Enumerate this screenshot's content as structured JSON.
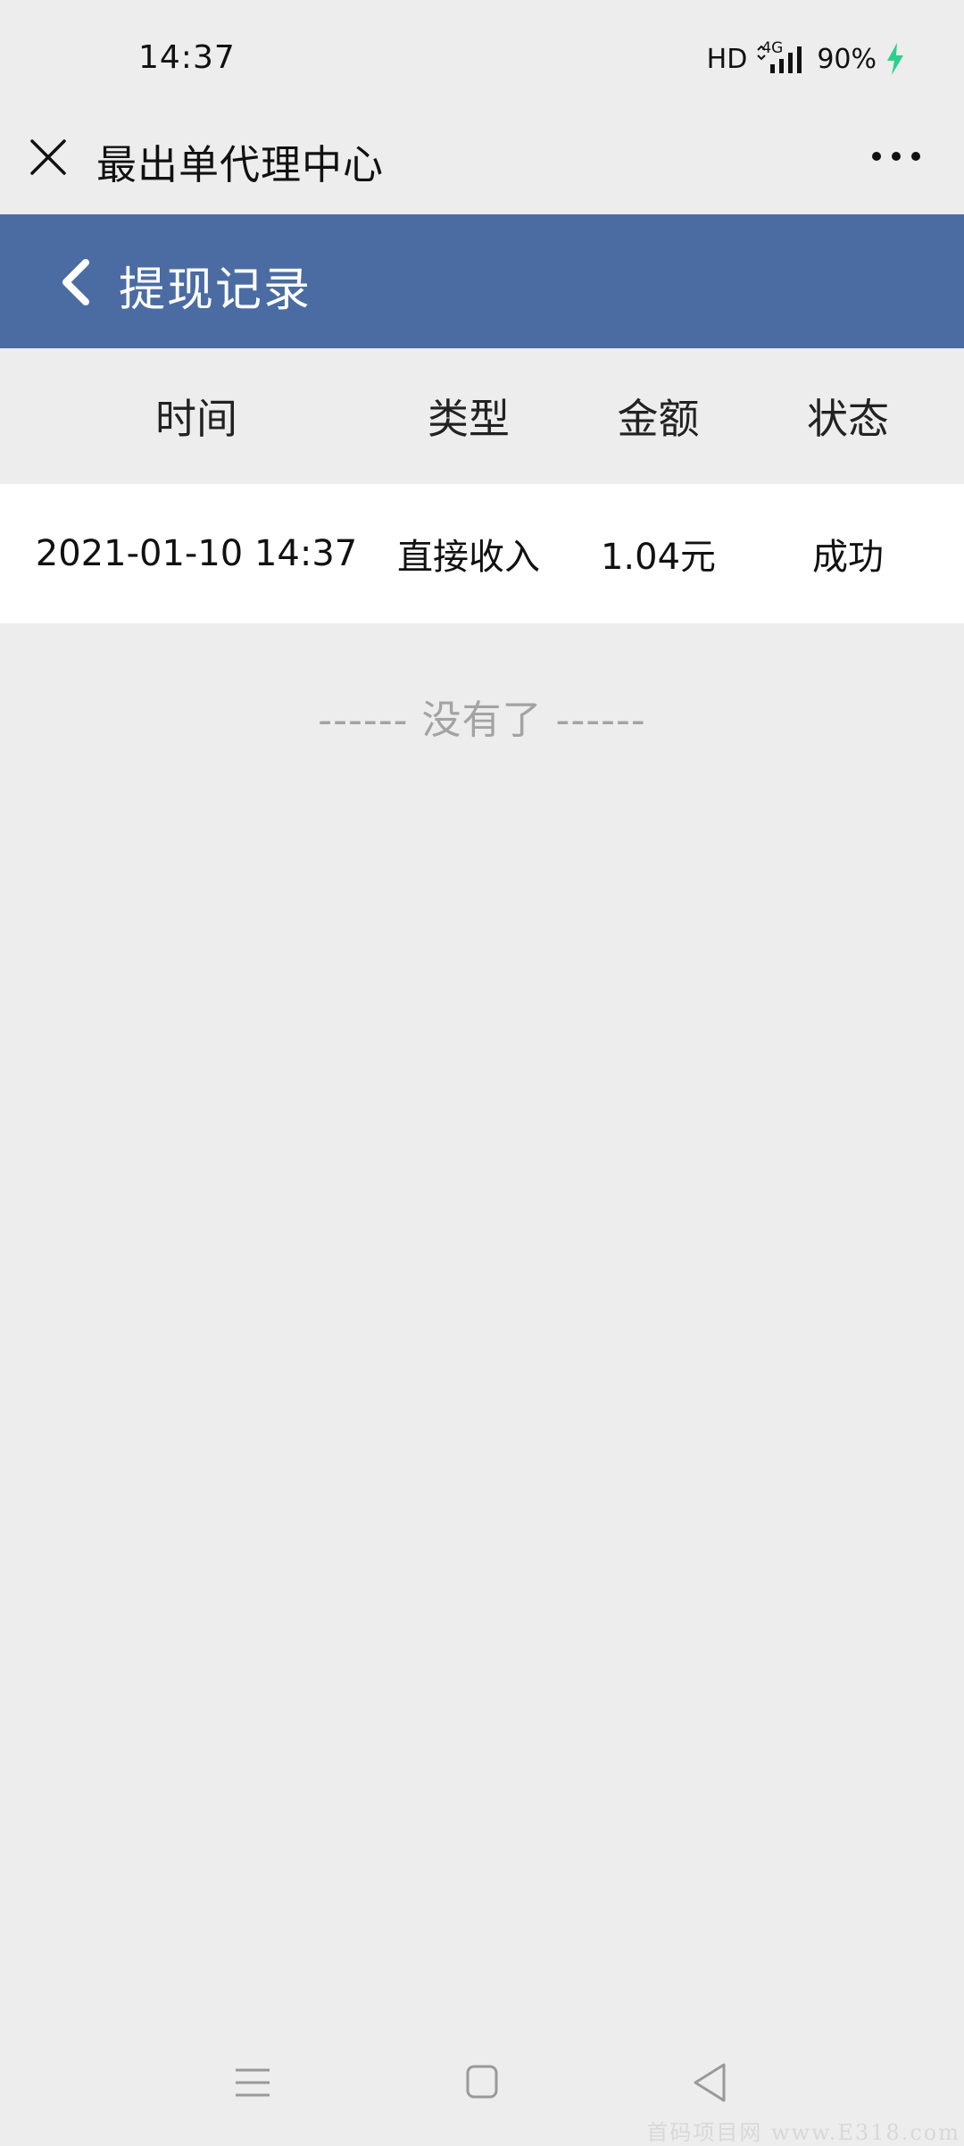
{
  "status_bar": {
    "time": "14:37",
    "hd": "HD",
    "network": "4G",
    "battery": "90%",
    "battery_color": "#2bd18a"
  },
  "titlebar": {
    "title": "最出单代理中心",
    "close_icon": "close-icon",
    "more_icon": "more-icon"
  },
  "page_header": {
    "title": "提现记录",
    "back_icon": "chevron-left-icon",
    "background": "#4b6ca2"
  },
  "table": {
    "columns": [
      "时间",
      "类型",
      "金额",
      "状态"
    ],
    "rows": [
      [
        "2021-01-10 14:37",
        "直接收入",
        "1.04元",
        "成功"
      ]
    ]
  },
  "end_text": "------ 没有了 ------",
  "navbar": {
    "icons": [
      "menu-icon",
      "home-square-icon",
      "back-triangle-icon"
    ]
  },
  "watermark": "首码项目网 www.E318.com"
}
